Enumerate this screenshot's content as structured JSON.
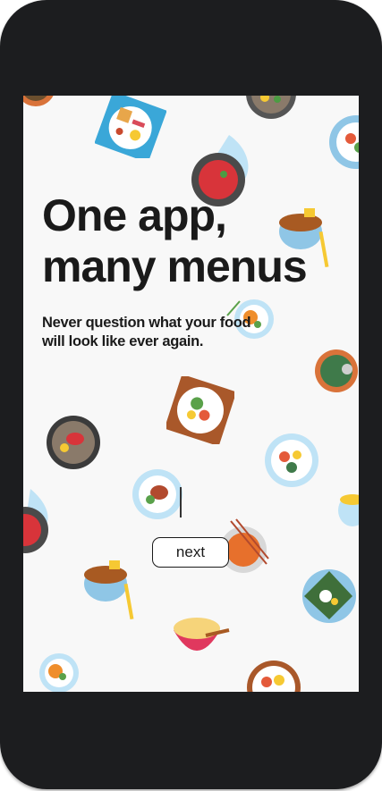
{
  "onboarding": {
    "title_line1": "One app,",
    "title_line2": "many menus",
    "subtitle": "Never question what your food will look like ever again.",
    "next_label": "next"
  },
  "colors": {
    "device_frame": "#1c1d1f",
    "screen_background": "#f8f8f8",
    "text": "#1a1a1a"
  },
  "decorations": [
    "breakfast-plate-icon",
    "tomato-soup-bowl-icon",
    "dark-plate-icon",
    "soup-bowl-icon",
    "rice-bowl-icon",
    "salad-plate-icon",
    "steak-plate-icon",
    "noodle-bowl-icon",
    "dumpling-bowl-icon",
    "leaf-wrap-icon",
    "curry-bowl-icon",
    "green-soup-icon"
  ]
}
